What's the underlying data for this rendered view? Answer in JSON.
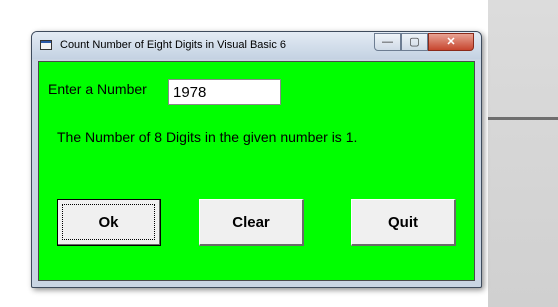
{
  "window": {
    "title": "Count Number of Eight Digits in Visual Basic 6",
    "controls": {
      "minimize_glyph": "—",
      "maximize_glyph": "▢",
      "close_glyph": "✕"
    }
  },
  "form": {
    "background": "#00ff00",
    "label_enter": "Enter a Number",
    "input_value": "1978",
    "result_text": "The Number of 8 Digits in the given number is 1."
  },
  "buttons": {
    "ok_label": "Ok",
    "clear_label": "Clear",
    "quit_label": "Quit"
  }
}
